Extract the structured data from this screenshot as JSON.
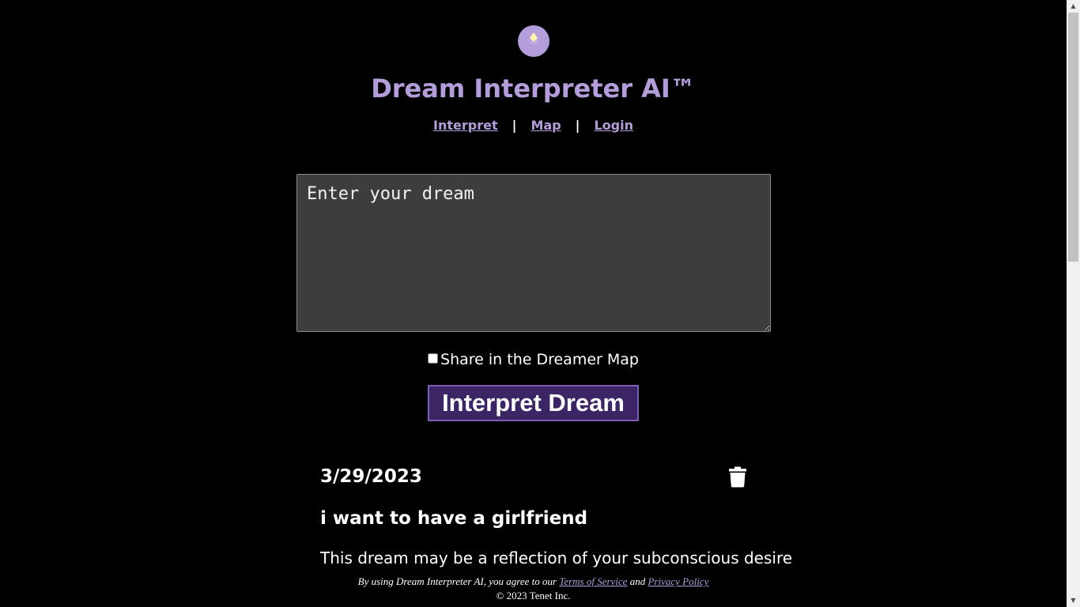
{
  "app": {
    "title": "Dream Interpreter AI™",
    "logo_icon": "sparkle-icon",
    "brand_color": "#b39ddb"
  },
  "nav": {
    "items": [
      {
        "label": "Interpret"
      },
      {
        "label": "Map"
      },
      {
        "label": "Login"
      }
    ],
    "separator": "|"
  },
  "form": {
    "dream_placeholder": "Enter your dream",
    "dream_value": "",
    "share_label": "Share in the Dreamer Map",
    "share_checked": false,
    "submit_label": "Interpret Dream"
  },
  "entries": [
    {
      "date": "3/29/2023",
      "dream": "i want to have a girlfriend",
      "interpretation": "This dream may be a reflection of your subconscious desire",
      "delete_icon": "trash-icon"
    }
  ],
  "footer": {
    "agree_prefix": "By using Dream Interpreter AI, you agree to our",
    "terms_label": "Terms of Service",
    "and_text": "and",
    "privacy_label": "Privacy Policy",
    "copyright": "© 2023 Tenet Inc."
  }
}
